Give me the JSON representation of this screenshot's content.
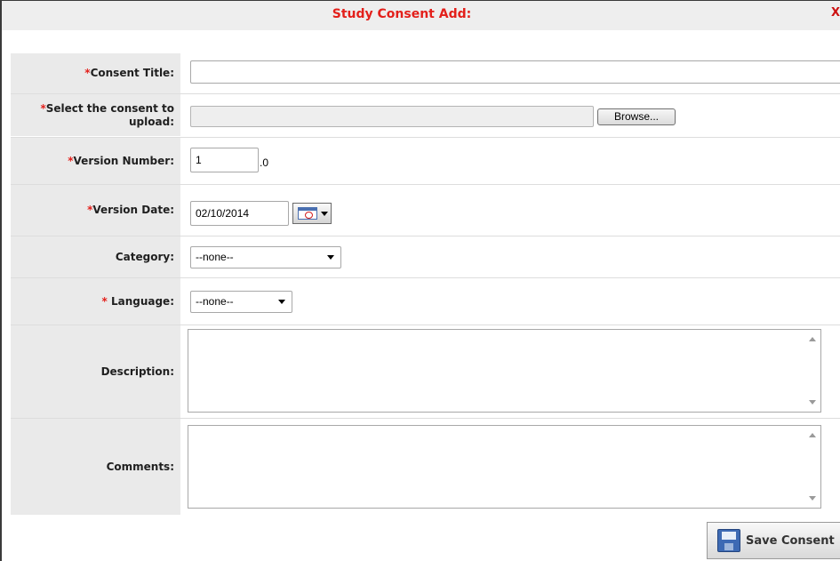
{
  "dialog": {
    "title": "Study Consent Add:",
    "close_glyph": "X"
  },
  "form": {
    "required_marker": "*",
    "consent_title": {
      "label": "Consent Title:",
      "value": ""
    },
    "upload": {
      "label": "Select the consent to upload:",
      "value": "",
      "browse_label": "Browse..."
    },
    "version_number": {
      "label": "Version Number:",
      "value": "1",
      "suffix": ".0"
    },
    "version_date": {
      "label": "Version Date:",
      "value": "02/10/2014",
      "calendar_icon": "calendar-icon"
    },
    "category": {
      "label": "Category:",
      "selected": "--none--"
    },
    "language": {
      "label": " Language:",
      "selected": "--none--"
    },
    "description": {
      "label": "Description:",
      "value": ""
    },
    "comments": {
      "label": "Comments:",
      "value": ""
    }
  },
  "actions": {
    "save_label": "Save Consent",
    "save_icon": "save-icon"
  },
  "colors": {
    "title": "#e3201b",
    "required": "#e3201b",
    "label_bg": "#eaeaea"
  }
}
